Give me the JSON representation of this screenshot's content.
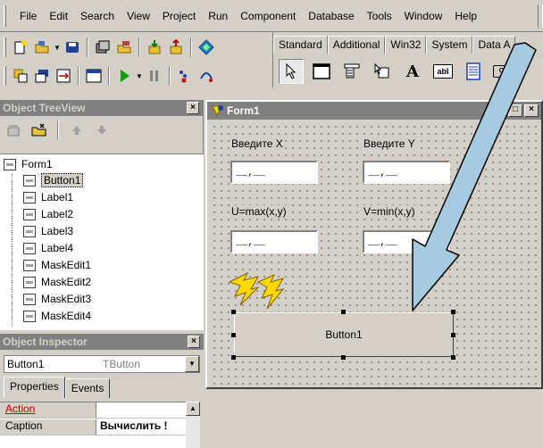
{
  "menu": [
    "File",
    "Edit",
    "Search",
    "View",
    "Project",
    "Run",
    "Component",
    "Database",
    "Tools",
    "Window",
    "Help"
  ],
  "palette": {
    "tabs": [
      "Standard",
      "Additional",
      "Win32",
      "System",
      "Data A"
    ],
    "active_tab": "Standard",
    "label_icon_text": "A",
    "edit_icon_text": "abI",
    "button_icon_text": "OK"
  },
  "treeview": {
    "title": "Object TreeView",
    "close": "×",
    "root": "Form1",
    "children": [
      "Button1",
      "Label1",
      "Label2",
      "Label3",
      "Label4",
      "MaskEdit1",
      "MaskEdit2",
      "MaskEdit3",
      "MaskEdit4"
    ],
    "selected": "Button1"
  },
  "inspector": {
    "title": "Object Inspector",
    "close": "×",
    "object_name": "Button1",
    "object_type": "TButton",
    "tabs": [
      "Properties",
      "Events"
    ],
    "active_tab": "Properties",
    "properties": [
      {
        "name": "Action",
        "value": ""
      },
      {
        "name": "Caption",
        "value": "Вычислить !"
      }
    ]
  },
  "form": {
    "title": "Form1",
    "label_x": "Введите X",
    "label_y": "Введите Y",
    "label_u": "U=max(x,y)",
    "label_v": "V=min(x,y)",
    "mask_placeholder": "__,__",
    "button_caption": "Button1",
    "min_btn": "_",
    "max_btn": "□",
    "close_btn": "×"
  },
  "colors": {
    "arrow": "#a6cae0",
    "bolt": "#ffd800",
    "title_inactive": "#808080"
  }
}
